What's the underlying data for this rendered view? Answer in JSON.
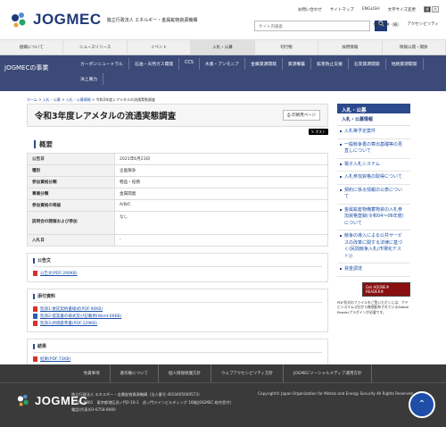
{
  "brand": {
    "logo_text": "JOGMEC",
    "org_name": "独立行政法人 エネルギー・金属鉱物資源機構"
  },
  "utility": {
    "links": [
      "お問い合わせ",
      "サイトマップ",
      "ENGLISH",
      "文字サイズ変更"
    ],
    "font_sizes": [
      "標準",
      "大"
    ]
  },
  "search": {
    "placeholder": "サイト内検索",
    "button_icon": "search-icon",
    "publications_label": "情報提供（紙）",
    "aux_label": "アクセシビリティ"
  },
  "nav": [
    "組織について",
    "ニュースリリース",
    "イベント",
    "入札・公募",
    "刊行物",
    "採用情報",
    "情報公開・関係"
  ],
  "business": {
    "title": "JOGMECの事業",
    "links": [
      "カーボンニュートラル",
      "石油・天然ガス開発",
      "CCS",
      "水素・アンモニア",
      "金属資源開発",
      "資源備蓄",
      "鉱害防止支援",
      "石炭資源開発",
      "地熱資源開発",
      "洋上風力"
    ]
  },
  "breadcrumb": [
    "ホーム",
    "入札・公募",
    "入札・公募情報",
    "令和3年度レアメタルの流通実態調査"
  ],
  "page": {
    "title": "令和3年度レアメタルの流通実態調査",
    "print_label": "印刷用ページ",
    "post_label": "ポスト"
  },
  "overview": {
    "heading": "概要",
    "rows": [
      {
        "k": "公告日",
        "v": "2021年6月23日"
      },
      {
        "k": "種別",
        "v": "企画競争"
      },
      {
        "k": "参加資格分類",
        "v": "物品・役務"
      },
      {
        "k": "事業分類",
        "v": "金属開発"
      },
      {
        "k": "参加資格の等級",
        "v": "A/B/C"
      },
      {
        "k": "説明会の開催および参加",
        "v": "なし"
      },
      {
        "k": "入札日",
        "v": "-"
      }
    ]
  },
  "notice": {
    "heading": "公告文",
    "files": [
      "公告文(PDF:290KB)"
    ]
  },
  "attachments": {
    "heading": "添付資料",
    "files": [
      "別添1:委託契約書様式(PDF:90KB)",
      "別添2:提案書の様式及び記載例(Word:66KB)",
      "別添3:評価基準書(PDF:129KB)"
    ]
  },
  "result": {
    "heading": "結果",
    "files": [
      "結果(PDF:73KB)"
    ]
  },
  "sidebar": {
    "heading": "入札・公募",
    "sub": "入札・公募情報",
    "items": [
      "入札等予定案件",
      "一般競争書の算出基礎等の見直しについて",
      "電子入札システム",
      "入札参加資格の取得について",
      "契約に係る情報の公表について",
      "金属鉱産物備蓄物資の入札参加資格登録(令和04～06年度)について",
      "競争の導入による公共サービスの改革に関する法律に基づく(民間競争入札(市場化テスト))",
      "資金調達"
    ],
    "reader_badge": "Get ADOBE® READER®",
    "reader_note": "PDF形式のファイルをご覧いただくには、アドビシステムズ社から無償配布されているAdobe Readerプラグインが必要です。"
  },
  "footer": {
    "links": [
      "免責事項",
      "著作権について",
      "個人情報保護方針",
      "ウェブアクセシビリティ方針",
      "JOGMECソーシャルメディア運用方針"
    ],
    "address": [
      "独立行政法人 エネルギー・金属鉱物資源機構（法人番号 4010405009573）",
      "〒105-0001　東京都港区虎ノ門2-10-1　虎ノ門ツインビルディング 16階(JOGMEC 総合受付)",
      "電話(代表)03-6758-8000"
    ],
    "copyright": "Copyright© Japan Organization for Metals and Energy Security All Rights Reserved."
  }
}
